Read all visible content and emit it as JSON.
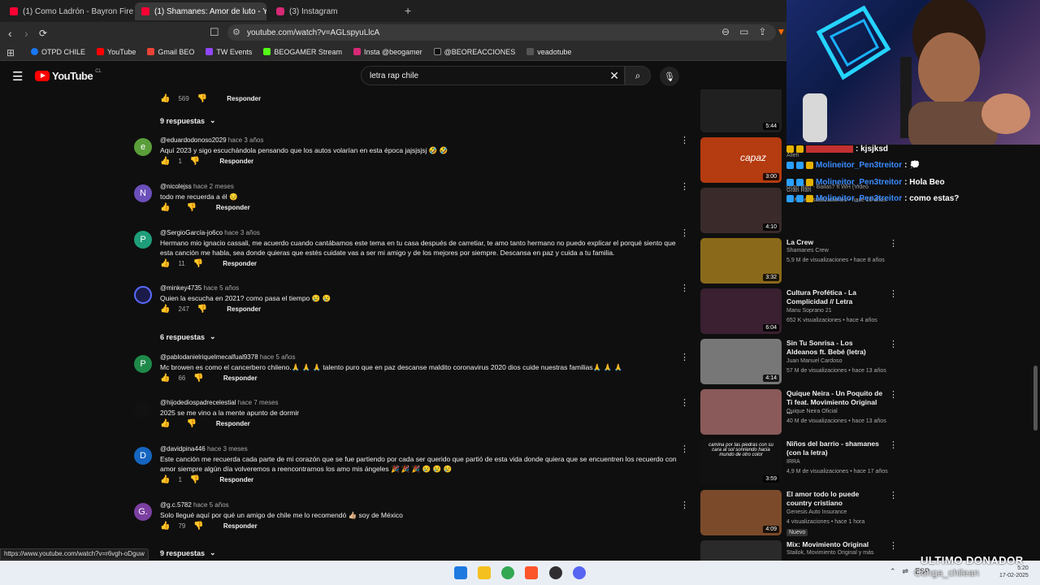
{
  "tabs": [
    {
      "label": "(1) Como Ladrón - Bayron Fire - (Prd",
      "active": false
    },
    {
      "label": "(1) Shamanes: Amor de luto - Yo",
      "active": true
    },
    {
      "label": "(3) Instagram",
      "active": false
    }
  ],
  "address": {
    "url": "youtube.com/watch?v=AGLspyuLlcA"
  },
  "bookmarks": [
    "OTPD CHILE",
    "YouTube",
    "Gmail BEO",
    "TW Events",
    "BEOGAMER Stream",
    "Insta @beogamer",
    "@BEOREACCIONES",
    "veadotube"
  ],
  "youtube": {
    "logo": "YouTube",
    "region": "CL",
    "search_value": "letra rap chile"
  },
  "top_actions": {
    "likes": "569",
    "reply": "Responder"
  },
  "replies_toggles": [
    "9 respuestas",
    "6 respuestas",
    "9 respuestas"
  ],
  "comments": [
    {
      "avatar": "e",
      "color": "#5a9e3a",
      "user": "@eduardodonoso2029",
      "time": "hace 3 años",
      "text": "Aquí 2023 y sigo escuchándola pensando que los autos volarían en esta época jajsjsjsj 🤣 🤣",
      "likes": "1",
      "reply": "Responder"
    },
    {
      "avatar": "N",
      "color": "#6b4fbb",
      "user": "@nicolejss",
      "time": "hace 2 meses",
      "text": "todo me recuerda a él 😔",
      "likes": "",
      "reply": "Responder"
    },
    {
      "avatar": "P",
      "color": "#1e9e7a",
      "user": "@SergioGarcía-jo6co",
      "time": "hace 3 años",
      "text": "Hermano mio ignacio cassali, me acuerdo cuando cantábamos este tema en tu casa después de carretiar, te amo tanto hermano no puedo explicar el porqué siento que esta canción me habla, sea donde quieras que estés cuidate vas a ser mi amigo y de los mejores por siempre. Descansa en paz y cuida a tu familia.",
      "likes": "11",
      "reply": "Responder"
    },
    {
      "avatar": "",
      "color": "#1b1b4a",
      "user": "@minkey4735",
      "time": "hace 5 años",
      "text": "Quien la escucha en 2021? como pasa el tiempo 😢 😢",
      "likes": "247",
      "reply": "Responder"
    },
    {
      "avatar": "P",
      "color": "#1e8a4a",
      "user": "@pablodanielriquelmecalfual9378",
      "time": "hace 5 años",
      "text": "Mc browen es como el cancerbero chileno.🙏 🙏 🙏 talento puro que en paz descanse maldito coronavirus 2020 dios cuide nuestras familias🙏 🙏 🙏",
      "likes": "66",
      "reply": "Responder"
    },
    {
      "avatar": "",
      "color": "#111111",
      "user": "@hijodediospadrecelestial",
      "time": "hace 7 meses",
      "text": "2025 se me vino a la mente apunto de dormir",
      "likes": "",
      "reply": "Responder"
    },
    {
      "avatar": "D",
      "color": "#1565c0",
      "user": "@davidpina446",
      "time": "hace 3 meses",
      "text": "Este canción me recuerda cada parte de mi corazón que se fue partiendo por cada ser querido que partió de esta vida donde quiera que se encuentren los recuerdo con amor siempre algún día volveremos a reencontrarnos los amo mis ángeles 🎉 🎉 🎉 😢 😢 😢",
      "likes": "1",
      "reply": "Responder"
    },
    {
      "avatar": "G.",
      "color": "#7b3fa0",
      "user": "@g.c.5782",
      "time": "hace 5 años",
      "text": "Solo llegué aquí por qué un amigo de chile me lo recomendó 👍🏼 soy de  México",
      "likes": "79",
      "reply": "Responder"
    }
  ],
  "sidebar_videos": [
    {
      "title": "",
      "channel": "",
      "meta": "",
      "duration": "5:44",
      "thumb": "#202020"
    },
    {
      "title": "",
      "channel": "",
      "meta": "",
      "duration": "3:00",
      "thumb": "#b53b10",
      "thumb_text": "capaz"
    },
    {
      "title": "",
      "channel": "Gran Rah",
      "meta": "13 M de visualizaciones • hace 10 años",
      "duration": "4:10",
      "thumb": "#3a2a2a"
    },
    {
      "title": "La Crew",
      "channel": "Shamanes Crew",
      "meta": "5,9 M de visualizaciones • hace 8 años",
      "duration": "3:32",
      "thumb": "#8a6a1a"
    },
    {
      "title": "Cultura Profética - La Complicidad // Letra",
      "channel": "Manu Soprano 21",
      "meta": "652 K visualizaciones • hace 4 años",
      "duration": "6:04",
      "thumb": "#3a2030"
    },
    {
      "title": "Sin Tu Sonrisa - Los Aldeanos ft. Bebé (letra)",
      "channel": "Juan Manuel Cardoso",
      "meta": "57 M de visualizaciones • hace 13 años",
      "duration": "4:14",
      "thumb": "#777777"
    },
    {
      "title": "Quique Neira - Un Poquito de Ti feat. Movimiento Original ...",
      "channel": "Quique Neira Oficial",
      "meta": "40 M de visualizaciones • hace 13 años",
      "duration": "",
      "thumb": "#8a5a5a"
    },
    {
      "title": "Niños del barrio - shamanes (con la letra)",
      "channel": "IRRA",
      "meta": "4,9 M de visualizaciones • hace 17 años",
      "duration": "3:59",
      "thumb": "#111111",
      "thumb_text": "camina por las piedras con su cara al sol sonriendo hacia mundo de otro color"
    },
    {
      "title": "El amor todo lo puede country cristiano",
      "channel": "Genesis Auto Insurance",
      "meta": "4 visualizaciones • hace 1 hora",
      "duration": "4:09",
      "thumb": "#7a4a2a",
      "badge": "Nuevo"
    },
    {
      "title": "Mix: Movimiento Original",
      "channel": "Stailok, Movimiento Original y más",
      "meta": "",
      "duration": "",
      "thumb": "#2a2a2a"
    }
  ],
  "overlay": {
    "chat": [
      {
        "user": "",
        "msg": ": kjsjksd"
      },
      {
        "user": "Molineitor_Pen3treitor",
        "msg": ":"
      },
      {
        "user": "Molineitor_Pen3treitor",
        "msg": ": Hola Beo"
      },
      {
        "user": "Molineitor_Pen3treitor",
        "msg": ": como estas?"
      }
    ],
    "under_text": [
      "Alleh",
      "Gran Rah - Bailas? ft WH (Video"
    ],
    "donor_title": "ULTIMO DONADOR",
    "donor_name": "Conga_chilean"
  },
  "status_url": "https://www.youtube.com/watch?v=r6vgh-oDguw",
  "tray": {
    "lang": "ESP",
    "time": "5:20",
    "date": "17-02-2025"
  }
}
